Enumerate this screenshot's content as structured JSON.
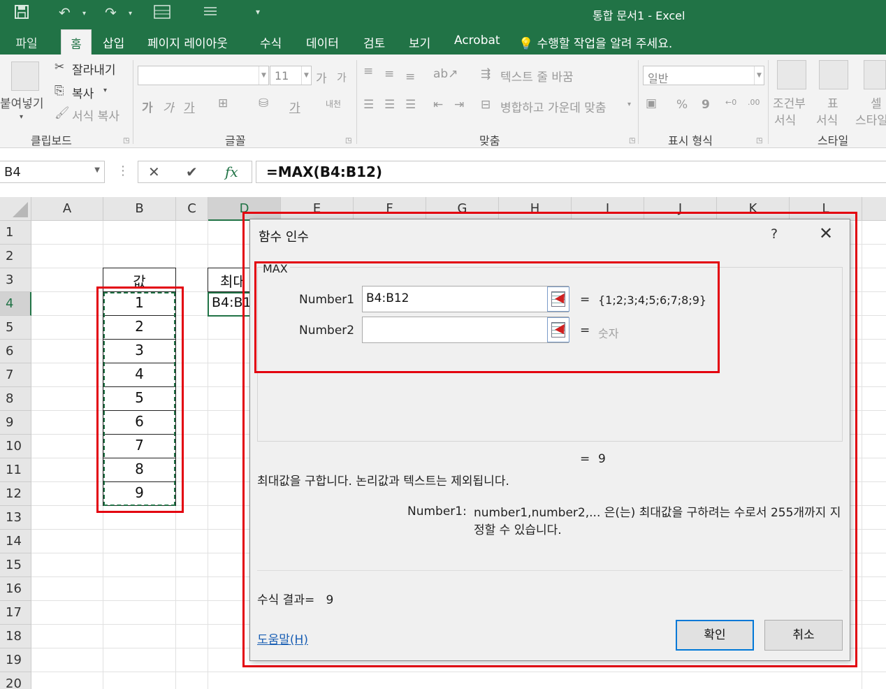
{
  "window": {
    "title": "통합 문서1 - Excel"
  },
  "quick_access": {
    "icons": [
      "save-icon",
      "undo-icon",
      "redo-icon",
      "form-icon",
      "list-icon",
      "customize-icon"
    ]
  },
  "tabs": {
    "file": "파일",
    "items": [
      "홈",
      "삽입",
      "페이지 레이아웃",
      "수식",
      "데이터",
      "검토",
      "보기",
      "Acrobat"
    ],
    "active": "홈",
    "tell_me": "수행할 작업을 알려 주세요."
  },
  "ribbon": {
    "clipboard": {
      "paste": "붙여넣기",
      "cut": "잘라내기",
      "copy": "복사",
      "format_painter": "서식 복사",
      "label": "클립보드"
    },
    "font": {
      "font_name": "",
      "font_size": "11",
      "grow": "가",
      "shrink": "가",
      "bold": "가",
      "italic": "가",
      "underline": "가",
      "font_color": "가",
      "phonetic": "내천",
      "label": "글꼴"
    },
    "alignment": {
      "wrap_text": "텍스트 줄 바꿈",
      "merge_center": "병합하고 가운데 맞춤",
      "label": "맞춤"
    },
    "number": {
      "format": "일반",
      "percent": "%",
      "comma": "9",
      "label": "표시 형식"
    },
    "styles": {
      "conditional_line1": "조건부",
      "conditional_line2": "서식",
      "table_line1": "표",
      "table_line2": "서식",
      "cell_line1": "셀",
      "cell_line2": "스타일",
      "label": "스타일"
    }
  },
  "formula_bar": {
    "name_box": "B4",
    "cancel": "✕",
    "enter": "✔",
    "fx": "fx",
    "formula": "=MAX(B4:B12)"
  },
  "grid": {
    "columns": [
      "A",
      "B",
      "C",
      "D",
      "E",
      "F",
      "G",
      "H",
      "I",
      "J",
      "K",
      "L"
    ],
    "selected_column": "D",
    "rows": [
      "1",
      "2",
      "3",
      "4",
      "5",
      "6",
      "7",
      "8",
      "9",
      "10",
      "11",
      "12",
      "13",
      "14",
      "15",
      "16",
      "17",
      "18",
      "19",
      "20"
    ],
    "selected_row": "4",
    "header_b3": "값",
    "values_b": [
      "1",
      "2",
      "3",
      "4",
      "5",
      "6",
      "7",
      "8",
      "9"
    ],
    "header_d3": "최대",
    "d4_text": "B4:B1"
  },
  "dialog": {
    "title": "함수 인수",
    "help": "?",
    "close": "✕",
    "function_name": "MAX",
    "args": [
      {
        "label": "Number1",
        "value": "B4:B12",
        "eq": "=",
        "result": "{1;2;3;4;5;6;7;8;9}"
      },
      {
        "label": "Number2",
        "value": "",
        "eq": "=",
        "result": "숫자"
      }
    ],
    "overall_eq": "=",
    "overall_result": "9",
    "description": "최대값을 구합니다. 논리값과 텍스트는 제외됩니다.",
    "arg_desc_label": "Number1:",
    "arg_desc_text": "number1,number2,... 은(는) 최대값을 구하려는 수로서 255개까지 지정할 수 있습니다.",
    "formula_result_label": "수식 결과=",
    "formula_result_value": "9",
    "help_link": "도움말(H)",
    "ok": "확인",
    "cancel": "취소"
  },
  "colors": {
    "excel_green": "#217346",
    "highlight_red": "#e3000f",
    "focus_blue": "#0078d7"
  }
}
